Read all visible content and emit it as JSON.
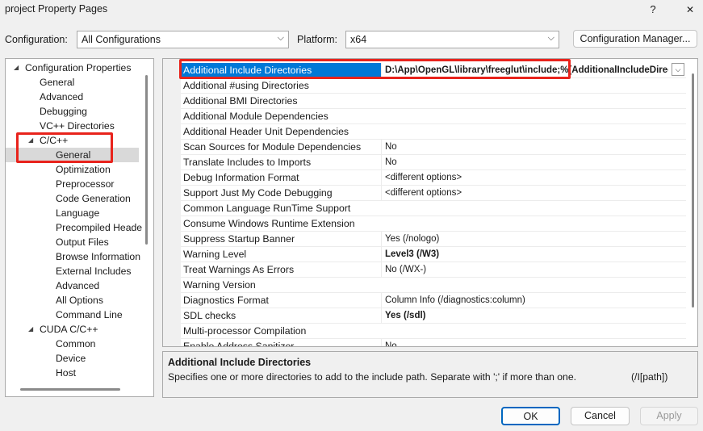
{
  "window": {
    "title": "project Property Pages",
    "help": "?",
    "close": "✕"
  },
  "config": {
    "label": "Configuration:",
    "value": "All Configurations"
  },
  "platform": {
    "label": "Platform:",
    "value": "x64"
  },
  "config_manager_label": "Configuration Manager...",
  "tree": [
    {
      "label": "Configuration Properties",
      "level": 0,
      "expanded": true
    },
    {
      "label": "General",
      "level": 1
    },
    {
      "label": "Advanced",
      "level": 1
    },
    {
      "label": "Debugging",
      "level": 1
    },
    {
      "label": "VC++ Directories",
      "level": 1
    },
    {
      "label": "C/C++",
      "level": 1,
      "expanded": true
    },
    {
      "label": "General",
      "level": 2,
      "selected": true
    },
    {
      "label": "Optimization",
      "level": 2
    },
    {
      "label": "Preprocessor",
      "level": 2
    },
    {
      "label": "Code Generation",
      "level": 2
    },
    {
      "label": "Language",
      "level": 2
    },
    {
      "label": "Precompiled Heade",
      "level": 2
    },
    {
      "label": "Output Files",
      "level": 2
    },
    {
      "label": "Browse Information",
      "level": 2
    },
    {
      "label": "External Includes",
      "level": 2
    },
    {
      "label": "Advanced",
      "level": 2
    },
    {
      "label": "All Options",
      "level": 2
    },
    {
      "label": "Command Line",
      "level": 2
    },
    {
      "label": "CUDA C/C++",
      "level": 1,
      "expanded": true
    },
    {
      "label": "Common",
      "level": 2
    },
    {
      "label": "Device",
      "level": 2
    },
    {
      "label": "Host",
      "level": 2
    }
  ],
  "properties": [
    {
      "name": "Additional Include Directories",
      "value": "D:\\App\\OpenGL\\library\\freeglut\\include;%(AdditionalIncludeDirectories)",
      "selected": true
    },
    {
      "name": "Additional #using Directories",
      "value": ""
    },
    {
      "name": "Additional BMI Directories",
      "value": ""
    },
    {
      "name": "Additional Module Dependencies",
      "value": ""
    },
    {
      "name": "Additional Header Unit Dependencies",
      "value": ""
    },
    {
      "name": "Scan Sources for Module Dependencies",
      "value": "No"
    },
    {
      "name": "Translate Includes to Imports",
      "value": "No"
    },
    {
      "name": "Debug Information Format",
      "value": "<different options>"
    },
    {
      "name": "Support Just My Code Debugging",
      "value": "<different options>"
    },
    {
      "name": "Common Language RunTime Support",
      "value": ""
    },
    {
      "name": "Consume Windows Runtime Extension",
      "value": ""
    },
    {
      "name": "Suppress Startup Banner",
      "value": "Yes (/nologo)"
    },
    {
      "name": "Warning Level",
      "value": "Level3 (/W3)",
      "bold": true
    },
    {
      "name": "Treat Warnings As Errors",
      "value": "No (/WX-)"
    },
    {
      "name": "Warning Version",
      "value": ""
    },
    {
      "name": "Diagnostics Format",
      "value": "Column Info (/diagnostics:column)"
    },
    {
      "name": "SDL checks",
      "value": "Yes (/sdl)",
      "bold": true
    },
    {
      "name": "Multi-processor Compilation",
      "value": ""
    },
    {
      "name": "Enable Address Sanitizer",
      "value": "No"
    }
  ],
  "description": {
    "title": "Additional Include Directories",
    "text": "Specifies one or more directories to add to the include path. Separate with ';' if more than one.",
    "switch": "(/I[path])"
  },
  "buttons": {
    "ok": "OK",
    "cancel": "Cancel",
    "apply": "Apply"
  },
  "colors": {
    "highlight": "#e8231c",
    "selection": "#0078d7",
    "primary_border": "#0067c0"
  }
}
